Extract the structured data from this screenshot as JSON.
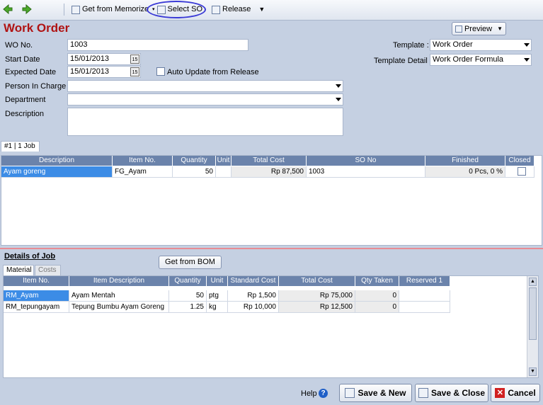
{
  "toolbar": {
    "memorize_label": "Get from Memorize",
    "select_so_label": "Select SO",
    "release_label": "Release"
  },
  "header": {
    "title": "Work Order",
    "preview_label": "Preview"
  },
  "form": {
    "wo_no_label": "WO No.",
    "wo_no_value": "1003",
    "start_date_label": "Start Date",
    "start_date_value": "15/01/2013",
    "expected_date_label": "Expected Date",
    "expected_date_value": "15/01/2013",
    "auto_update_label": "Auto Update from Release",
    "person_label": "Person In Charge",
    "department_label": "Department",
    "description_label": "Description",
    "template_label": "Template :",
    "template_value": "Work Order",
    "template_detail_label": "Template Detail :",
    "template_detail_value": "Work Order Formula"
  },
  "job_tab": "#1 | 1 Job",
  "jobs_table": {
    "headers": [
      "Description",
      "Item No.",
      "Quantity",
      "Unit",
      "Total Cost",
      "SO No",
      "Finished",
      "Closed"
    ],
    "rows": [
      {
        "description": "Ayam goreng",
        "item_no": "FG_Ayam",
        "quantity": "50",
        "unit": "",
        "total_cost": "Rp 87,500",
        "so_no": "1003",
        "finished": "0 Pcs, 0 %"
      }
    ]
  },
  "details": {
    "title": "Details of Job",
    "tab_material": "Material",
    "tab_costs": "Costs",
    "get_bom_label": "Get from BOM",
    "headers": [
      "Item No.",
      "Item Description",
      "Quantity",
      "Unit",
      "Standard Cost",
      "Total Cost",
      "Qty Taken",
      "Reserved 1"
    ],
    "rows": [
      {
        "item_no": "RM_Ayam",
        "desc": "Ayam Mentah",
        "qty": "50",
        "unit": "ptg",
        "std_cost": "Rp 1,500",
        "total": "Rp 75,000",
        "taken": "0",
        "reserved": ""
      },
      {
        "item_no": "RM_tepungayam",
        "desc": "Tepung Bumbu Ayam Goreng",
        "qty": "1.25",
        "unit": "kg",
        "std_cost": "Rp 10,000",
        "total": "Rp 12,500",
        "taken": "0",
        "reserved": ""
      }
    ]
  },
  "footer": {
    "help_label": "Help",
    "save_new_label": "Save & New",
    "save_close_label": "Save & Close",
    "cancel_label": "Cancel"
  }
}
